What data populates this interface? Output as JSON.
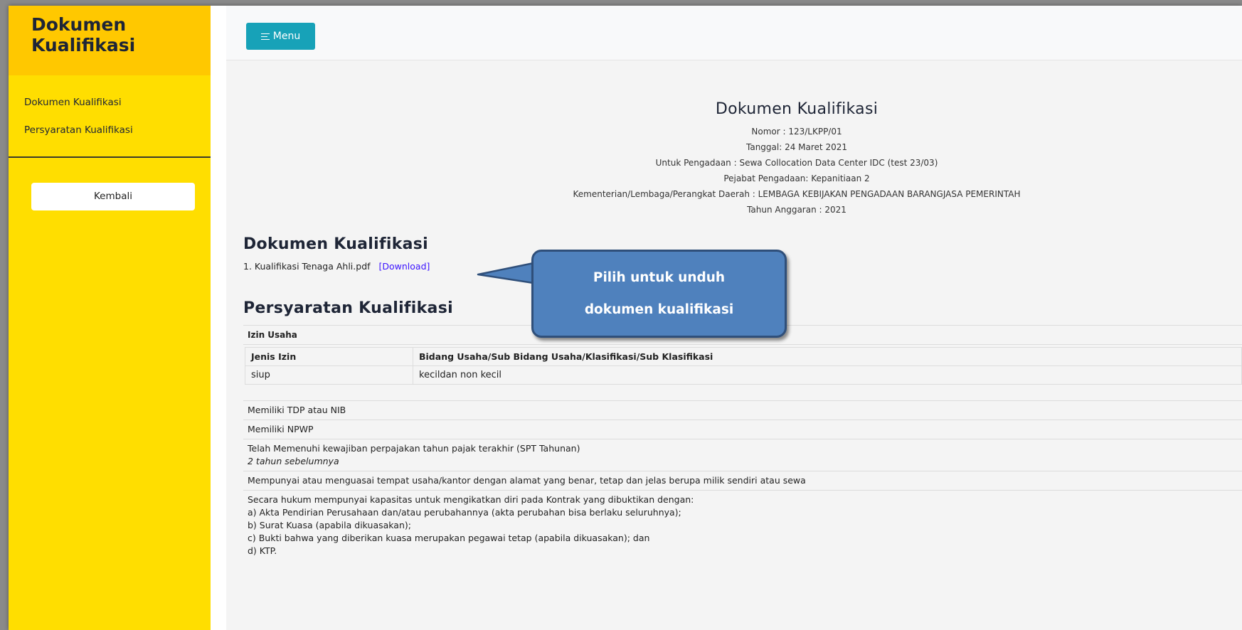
{
  "sidebar": {
    "brand_title": "Dokumen Kualifikasi",
    "links": [
      "Dokumen Kualifikasi",
      "Persyaratan Kualifikasi"
    ],
    "back_label": "Kembali"
  },
  "topbar": {
    "menu_label": "Menu",
    "menu_icon": "hamburger-icon"
  },
  "doc": {
    "title": "Dokumen Kualifikasi",
    "nomor": "Nomor : 123/LKPP/01",
    "tanggal": "Tanggal: 24 Maret 2021",
    "pengadaan": "Untuk Pengadaan : Sewa Collocation Data Center IDC (test 23/03)",
    "pejabat": "Pejabat Pengadaan: Kepanitiaan 2",
    "kementerian": "Kementerian/Lembaga/Perangkat Daerah : LEMBAGA KEBIJAKAN PENGADAAN BARANGJASA PEMERINTAH",
    "tahun": "Tahun Anggaran : 2021"
  },
  "dokumen_section": {
    "title": "Dokumen Kualifikasi",
    "file_name": "1. Kualifikasi Tenaga Ahli.pdf",
    "download_label": "[Download]"
  },
  "persyaratan_section": {
    "title": "Persyaratan Kualifikasi",
    "izin_label": "Izin Usaha",
    "table": {
      "headers": [
        "Jenis Izin",
        "Bidang Usaha/Sub Bidang Usaha/Klasifikasi/Sub Klasifikasi"
      ],
      "rows": [
        [
          "siup",
          "kecildan non kecil"
        ]
      ]
    },
    "items": {
      "tdp": "Memiliki TDP atau NIB",
      "npwp": "Memiliki NPWP",
      "pajak": "Telah Memenuhi kewajiban perpajakan tahun pajak terakhir (SPT Tahunan)",
      "pajak_sub": "2 tahun sebelumnya",
      "tempat": "Mempunyai atau menguasai tempat usaha/kantor dengan alamat yang benar, tetap dan jelas berupa milik sendiri atau sewa",
      "hukum": "Secara hukum mempunyai kapasitas untuk mengikatkan diri pada Kontrak yang dibuktikan dengan:",
      "hukum_a": "a) Akta Pendirian Perusahaan dan/atau perubahannya (akta perubahan bisa berlaku seluruhnya);",
      "hukum_b": "b) Surat Kuasa (apabila dikuasakan);",
      "hukum_c": "c) Bukti bahwa yang diberikan kuasa merupakan pegawai tetap (apabila dikuasakan); dan",
      "hukum_d": "d) KTP."
    }
  },
  "callout": {
    "line1": "Pilih untuk unduh",
    "line2": "dokumen kualifikasi"
  },
  "colors": {
    "sidebar_bg": "#ffde00",
    "sidebar_header_bg": "#ffc800",
    "menu_button": "#17a2b8",
    "callout_bg": "#4f81bd",
    "download_link": "#3a12ff"
  }
}
